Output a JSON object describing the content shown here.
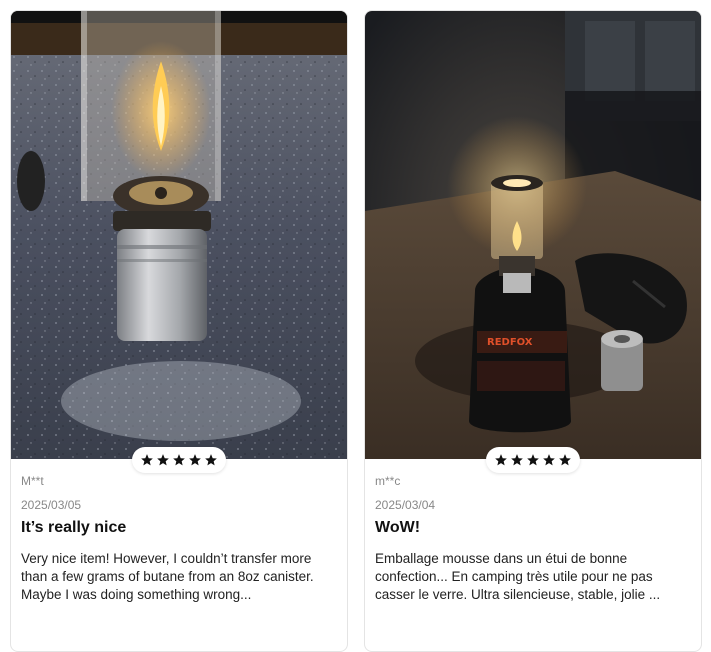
{
  "reviews": [
    {
      "user": "M**t",
      "date": "2025/03/05",
      "title": "It’s really nice",
      "body": "Very nice item! However, I couldn’t transfer more than a few grams of butane from an 8oz canister. Maybe I was doing something wrong...",
      "rating": 5
    },
    {
      "user": "m**c",
      "date": "2025/03/04",
      "title": "WoW!",
      "body": "Emballage mousse dans un étui de bonne confection... En camping très utile pour ne pas casser le verre. Ultra silencieuse, stable, jolie ...",
      "rating": 5
    }
  ],
  "canister_logo": "REDFOX",
  "colors": {
    "star": "#111111",
    "card_border": "#e4e4e4"
  },
  "icons": [
    "star-icon"
  ]
}
